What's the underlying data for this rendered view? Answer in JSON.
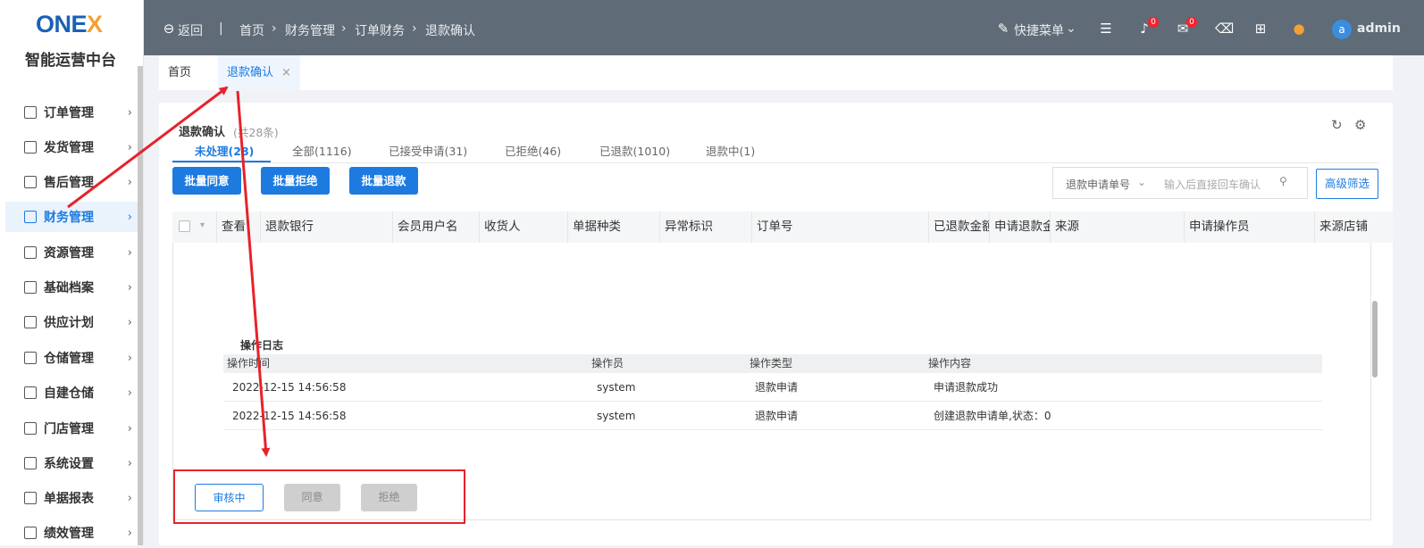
{
  "brand": {
    "logo_prefix": "ONE",
    "logo_x": "X",
    "name": "智能运营中台"
  },
  "sidebar": {
    "items": [
      {
        "label": "订单管理",
        "icon": "order-icon"
      },
      {
        "label": "发货管理",
        "icon": "truck-icon"
      },
      {
        "label": "售后管理",
        "icon": "aftersale-icon"
      },
      {
        "label": "财务管理",
        "icon": "finance-icon",
        "active": true
      },
      {
        "label": "资源管理",
        "icon": "resource-icon"
      },
      {
        "label": "基础档案",
        "icon": "archive-icon"
      },
      {
        "label": "供应计划",
        "icon": "supply-icon"
      },
      {
        "label": "仓储管理",
        "icon": "warehouse-icon"
      },
      {
        "label": "自建仓储",
        "icon": "home-warehouse-icon"
      },
      {
        "label": "门店管理",
        "icon": "store-icon"
      },
      {
        "label": "系统设置",
        "icon": "settings-icon"
      },
      {
        "label": "单据报表",
        "icon": "report-icon"
      },
      {
        "label": "绩效管理",
        "icon": "performance-icon"
      }
    ]
  },
  "header": {
    "back": "返回",
    "sep": "|",
    "breadcrumb": [
      "首页",
      "财务管理",
      "订单财务",
      "退款确认"
    ],
    "quick_menu": "快捷菜单",
    "notify_count": "0",
    "mail_count": "0",
    "user_initial": "a",
    "user": "admin"
  },
  "tabs": {
    "home": "首页",
    "current": "退款确认",
    "close": "×"
  },
  "page": {
    "title": "退款确认",
    "count": "(共28条)",
    "subtabs": [
      "未处理(28)",
      "全部(1116)",
      "已接受申请(31)",
      "已拒绝(46)",
      "已退款(1010)",
      "退款中(1)"
    ],
    "buttons": {
      "batch_agree": "批量同意",
      "batch_reject": "批量拒绝",
      "batch_refund": "批量退款"
    },
    "search": {
      "field": "退款申请单号",
      "placeholder": "输入后直接回车确认"
    },
    "advanced": "高级筛选",
    "columns": [
      "查看",
      "退款银行",
      "会员用户名",
      "收货人",
      "单据种类",
      "异常标识",
      "订单号",
      "已退款金额",
      "申请退款金额",
      "来源",
      "申请操作员",
      "来源店铺"
    ],
    "log": {
      "title": "操作日志",
      "headers": [
        "操作时间",
        "操作员",
        "操作类型",
        "操作内容"
      ],
      "rows": [
        [
          "2022-12-15 14:56:58",
          "system",
          "退款申请",
          "申请退款成功"
        ],
        [
          "2022-12-15 14:56:58",
          "system",
          "退款申请",
          "创建退款申请单,状态：0"
        ]
      ]
    },
    "actions": {
      "reviewing": "审核中",
      "agree": "同意",
      "reject": "拒绝"
    }
  },
  "colors": {
    "primary": "#1d7be0",
    "header_bg": "#5f6b76",
    "annotation": "#e8222a"
  }
}
